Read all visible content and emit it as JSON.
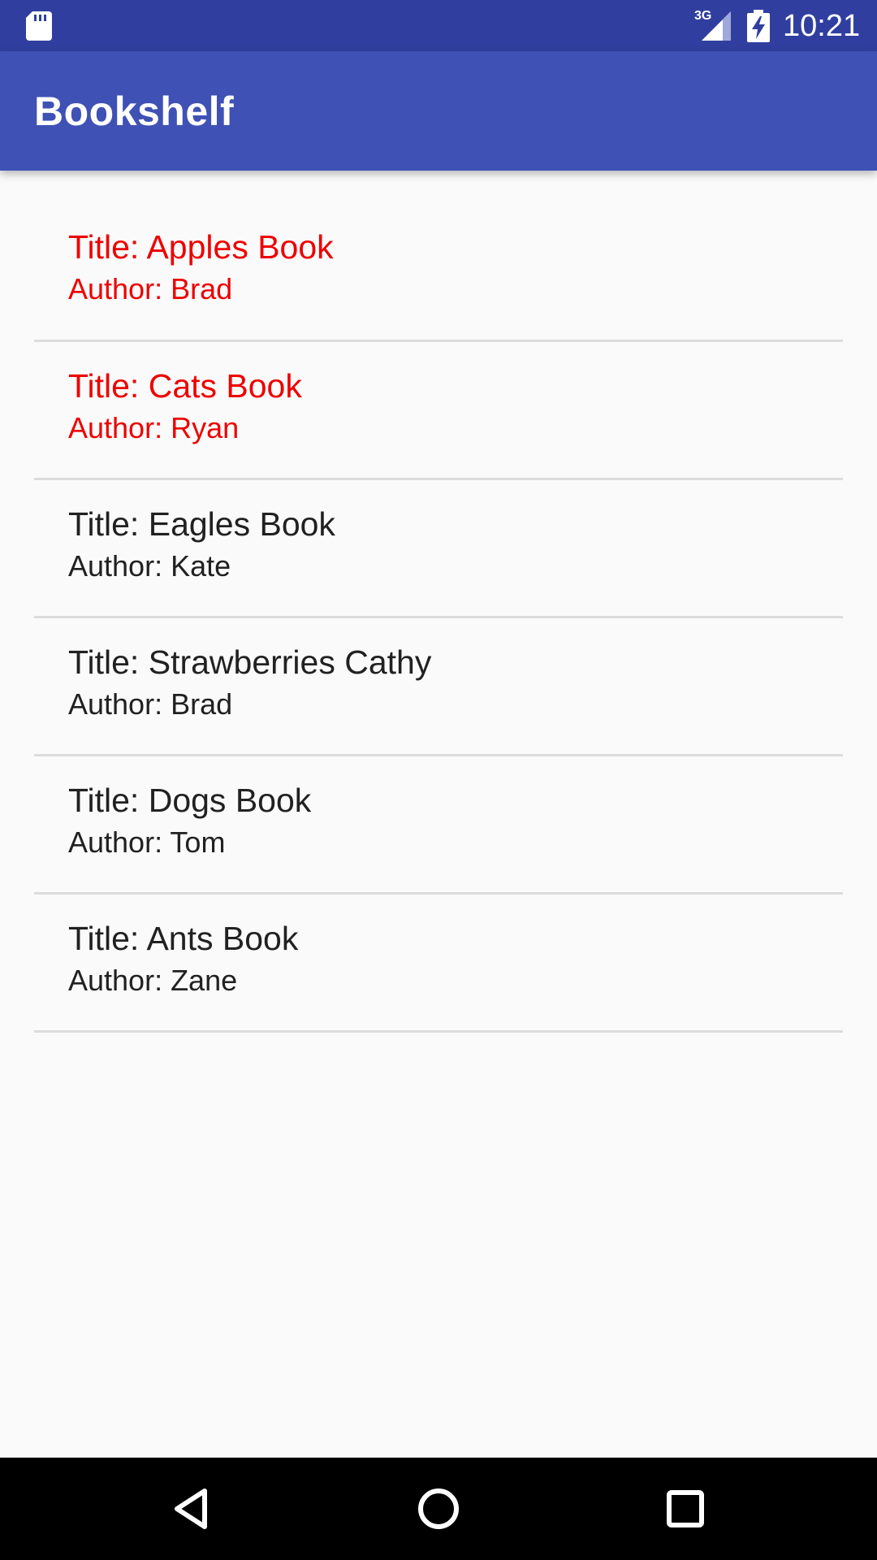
{
  "status_bar": {
    "network_type": "3G",
    "time": "10:21",
    "icons": [
      "sd-card-icon",
      "signal-icon",
      "battery-charging-icon"
    ]
  },
  "app_bar": {
    "title": "Bookshelf"
  },
  "books": [
    {
      "title": "Title: Apples Book",
      "author": "Author: Brad",
      "highlighted": true
    },
    {
      "title": "Title: Cats Book",
      "author": "Author: Ryan",
      "highlighted": true
    },
    {
      "title": "Title: Eagles Book",
      "author": "Author: Kate",
      "highlighted": false
    },
    {
      "title": "Title: Strawberries Cathy",
      "author": "Author: Brad",
      "highlighted": false
    },
    {
      "title": "Title: Dogs Book",
      "author": "Author: Tom",
      "highlighted": false
    },
    {
      "title": "Title: Ants Book",
      "author": "Author: Zane",
      "highlighted": false
    }
  ],
  "colors": {
    "status_bar": "#303f9f",
    "app_bar": "#3f51b5",
    "highlight_text": "#ee0000",
    "normal_text": "#212121",
    "background": "#fafafa"
  },
  "navigation": {
    "icons": [
      "back-icon",
      "home-icon",
      "recents-icon"
    ]
  }
}
